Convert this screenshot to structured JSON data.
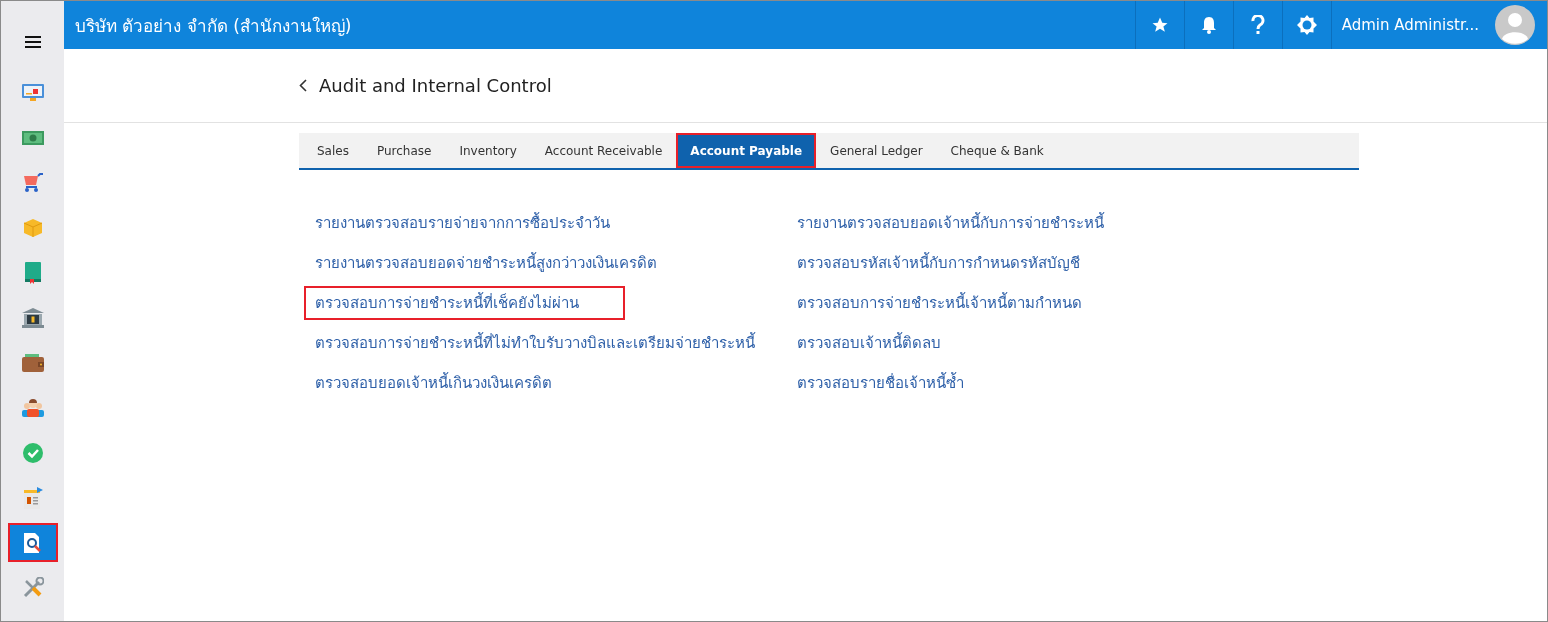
{
  "topbar": {
    "title": "บริษัท ตัวอย่าง จำกัด (สำนักงานใหญ่)",
    "user_name": "Admin Administr..."
  },
  "sidebar": {
    "items": [
      {
        "kind": "dashboard",
        "selected": false,
        "highlighted": false
      },
      {
        "kind": "money",
        "selected": false,
        "highlighted": false
      },
      {
        "kind": "cart",
        "selected": false,
        "highlighted": false
      },
      {
        "kind": "box",
        "selected": false,
        "highlighted": false
      },
      {
        "kind": "book",
        "selected": false,
        "highlighted": false
      },
      {
        "kind": "bank",
        "selected": false,
        "highlighted": false
      },
      {
        "kind": "wallet",
        "selected": false,
        "highlighted": false
      },
      {
        "kind": "people",
        "selected": false,
        "highlighted": false
      },
      {
        "kind": "check",
        "selected": false,
        "highlighted": false
      },
      {
        "kind": "invoice",
        "selected": false,
        "highlighted": false
      },
      {
        "kind": "audit",
        "selected": true,
        "highlighted": true
      },
      {
        "kind": "tools",
        "selected": false,
        "highlighted": false
      }
    ]
  },
  "page": {
    "title": "Audit and Internal Control"
  },
  "tabs": [
    {
      "label": "Sales",
      "selected": false,
      "highlighted": false
    },
    {
      "label": "Purchase",
      "selected": false,
      "highlighted": false
    },
    {
      "label": "Inventory",
      "selected": false,
      "highlighted": false
    },
    {
      "label": "Account Receivable",
      "selected": false,
      "highlighted": false
    },
    {
      "label": "Account Payable",
      "selected": true,
      "highlighted": true
    },
    {
      "label": "General Ledger",
      "selected": false,
      "highlighted": false
    },
    {
      "label": "Cheque & Bank",
      "selected": false,
      "highlighted": false
    }
  ],
  "report_columns": [
    [
      {
        "label": "รายงานตรวจสอบรายจ่ายจากการซื้อประจำวัน",
        "highlighted": false
      },
      {
        "label": "รายงานตรวจสอบยอดจ่ายชำระหนี้สูงกว่าวงเงินเครดิต",
        "highlighted": false
      },
      {
        "label": "ตรวจสอบการจ่ายชำระหนี้ที่เช็คยังไม่ผ่าน",
        "highlighted": true
      },
      {
        "label": "ตรวจสอบการจ่ายชำระหนี้ที่ไม่ทำใบรับวางบิลและเตรียมจ่ายชำระหนี้",
        "highlighted": false
      },
      {
        "label": "ตรวจสอบยอดเจ้าหนี้เกินวงเงินเครดิต",
        "highlighted": false
      }
    ],
    [
      {
        "label": "รายงานตรวจสอบยอดเจ้าหนี้กับการจ่ายชำระหนี้",
        "highlighted": false
      },
      {
        "label": "ตรวจสอบรหัสเจ้าหนี้กับการกำหนดรหัสบัญชี",
        "highlighted": false
      },
      {
        "label": "ตรวจสอบการจ่ายชำระหนี้เจ้าหนี้ตามกำหนด",
        "highlighted": false
      },
      {
        "label": "ตรวจสอบเจ้าหนี้ติดลบ",
        "highlighted": false
      },
      {
        "label": "ตรวจสอบรายชื่อเจ้าหนี้ซ้ำ",
        "highlighted": false
      }
    ]
  ]
}
